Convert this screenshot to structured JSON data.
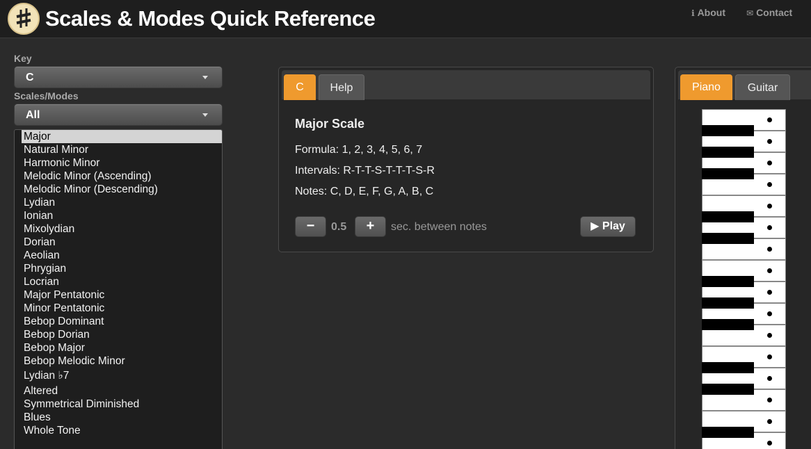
{
  "header": {
    "title": "Scales & Modes Quick Reference",
    "about_label": "About",
    "contact_label": "Contact",
    "about_icon": "info-icon",
    "contact_icon": "envelope-icon"
  },
  "sidebar": {
    "key_label": "Key",
    "key_value": "C",
    "scales_label": "Scales/Modes",
    "scales_value": "All",
    "scales": [
      "Major",
      "Natural Minor",
      "Harmonic Minor",
      "Melodic Minor (Ascending)",
      "Melodic Minor (Descending)",
      "Lydian",
      "Ionian",
      "Mixolydian",
      "Dorian",
      "Aeolian",
      "Phrygian",
      "Locrian",
      "Major Pentatonic",
      "Minor Pentatonic",
      "Bebop Dominant",
      "Bebop Dorian",
      "Bebop Major",
      "Bebop Melodic Minor",
      "Lydian ♭7",
      "Altered",
      "Symmetrical Diminished",
      "Blues",
      "Whole Tone"
    ],
    "selected_scale": "Major"
  },
  "info_panel": {
    "tabs": [
      "C",
      "Help"
    ],
    "active_tab": "C",
    "scale_name": "Major Scale",
    "formula": "Formula: 1, 2, 3, 4, 5, 6, 7",
    "intervals": "Intervals: R-T-T-S-T-T-T-S-R",
    "notes": "Notes: C, D, E, F, G, A, B, C",
    "minus_label": "−",
    "speed_value": "0.5",
    "plus_label": "+",
    "speed_label": "sec. between notes",
    "play_label": "▶ Play"
  },
  "instrument_panel": {
    "tabs": [
      "Piano",
      "Guitar"
    ],
    "active_tab": "Piano"
  },
  "colors": {
    "accent": "#ef9a2e",
    "background": "#2b2b2b",
    "header": "#1e1e1e"
  }
}
